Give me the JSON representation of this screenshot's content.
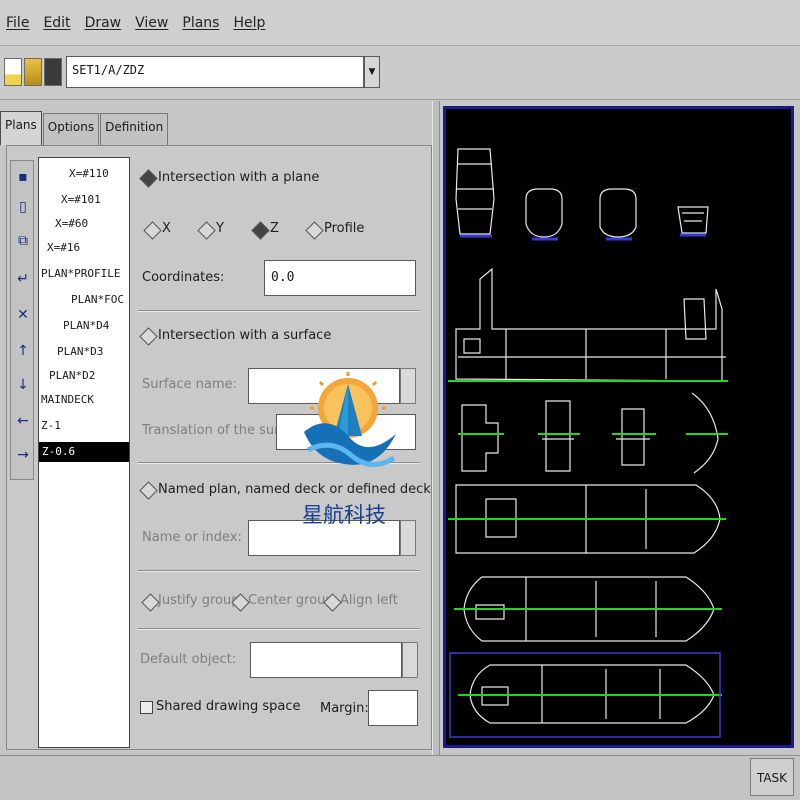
{
  "menu": [
    "File",
    "Edit",
    "Draw",
    "View",
    "Plans",
    "Help"
  ],
  "toolbar": {
    "path_value": "SET1/A/ZDZ",
    "icons": [
      "new-file-icon",
      "open-folder-icon",
      "save-disk-icon"
    ]
  },
  "tabs": [
    "Plans",
    "Options",
    "Definition"
  ],
  "side_toolbar_icons": [
    "select-icon",
    "new-plan-icon",
    "copy-plan-icon",
    "return-icon",
    "delete-icon",
    "move-up-icon",
    "move-down-icon",
    "move-left-icon",
    "move-right-icon"
  ],
  "plans": [
    "X=#110",
    "X=#101",
    "X=#60",
    "X=#16",
    "PLAN*PROFILE",
    "PLAN*FOC",
    "PLAN*D4",
    "PLAN*D3",
    "PLAN*D2",
    "MAINDECK",
    "Z-1",
    "Z-0.6"
  ],
  "selected_plan": "Z-0.6",
  "intersection_plane": {
    "label": "Intersection with a plane",
    "axes": [
      "X",
      "Y",
      "Z",
      "Profile"
    ],
    "selected_axis": "Z",
    "coordinates_label": "Coordinates:",
    "coordinates_value": "0.0"
  },
  "intersection_surface": {
    "label": "Intersection with a surface",
    "surface_name_label": "Surface name:",
    "surface_name_value": "",
    "translation_label": "Translation of the surface:",
    "translation_value": ""
  },
  "named_plan": {
    "label": "Named plan, named deck or defined deck",
    "name_index_label": "Name or index:",
    "name_index_value": ""
  },
  "justify": {
    "options": [
      "Justify group",
      "Center group",
      "Align left"
    ]
  },
  "default_object": {
    "label": "Default object:",
    "value": ""
  },
  "shared_drawing": {
    "label": "Shared drawing space",
    "checked": false,
    "margin_label": "Margin:",
    "margin_value": ""
  },
  "logo_text": "星航科技",
  "status": {
    "task_label": "TASK"
  },
  "colors": {
    "canvas_bg": "#000000",
    "canvas_border": "#1a1a8c",
    "waterline": "#22d622",
    "drawing": "#e8e8e8",
    "selection": "#3a3ad0"
  }
}
